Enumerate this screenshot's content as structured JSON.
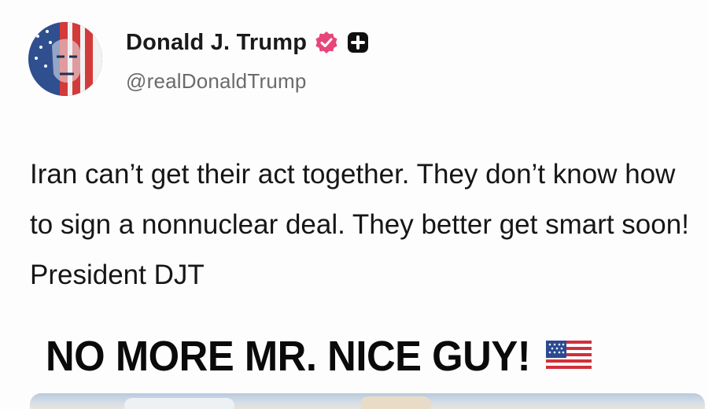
{
  "post": {
    "author": {
      "display_name": "Donald J. Trump",
      "handle": "@realDonaldTrump",
      "avatar_icon": "flag-portrait-avatar",
      "verified_badge_color": "#e8457a",
      "plus_badge_color": "#0f0f0f"
    },
    "text": "Iran can’t get their act together. They don’t know how to sign a nonnuclear deal. They better get smart soon! President DJT",
    "media": {
      "headline": "NO MORE MR. NICE GUY!",
      "headline_icon": "us-flag-icon"
    }
  }
}
